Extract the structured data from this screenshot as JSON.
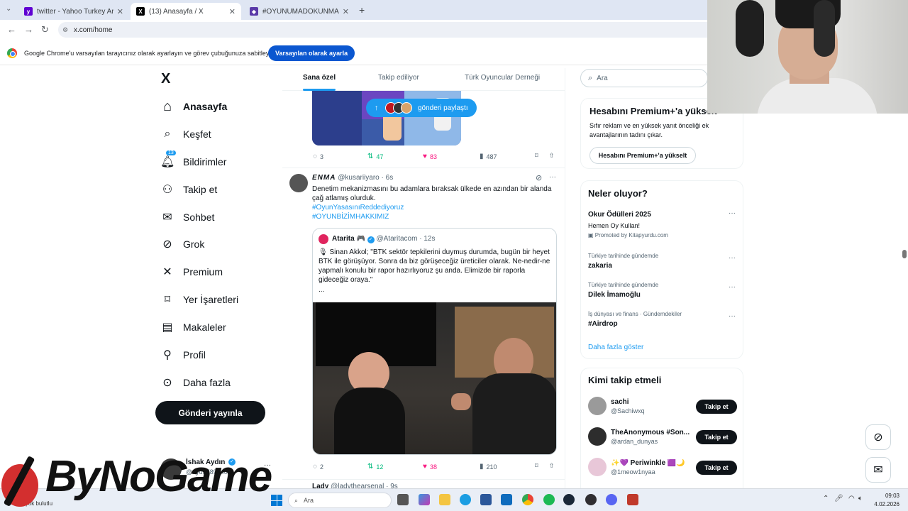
{
  "browser": {
    "tabs": [
      {
        "label": "twitter - Yahoo Turkey Arama S",
        "color": "#6001d2"
      },
      {
        "label": "(13) Anasayfa / X",
        "color": "#000000"
      },
      {
        "label": "#OYUNUMADOKUNMA - Dijita",
        "color": "#5a3aa8"
      }
    ],
    "new_tab": "+",
    "url": "x.com/home"
  },
  "infobar": {
    "message": "Google Chrome'u varsayılan tarayıcınız olarak ayarlayın ve görev çubuğunuza sabitleyin",
    "button": "Varsayılan olarak ayarla"
  },
  "nav": {
    "logo": "X",
    "items": [
      {
        "label": "Anasayfa",
        "icon": "home-icon",
        "glyph": "⌂"
      },
      {
        "label": "Keşfet",
        "icon": "search-icon",
        "glyph": "⌕"
      },
      {
        "label": "Bildirimler",
        "icon": "bell-icon",
        "glyph": "♫",
        "badge": "13"
      },
      {
        "label": "Takip et",
        "icon": "person-add-icon",
        "glyph": "⚇"
      },
      {
        "label": "Sohbet",
        "icon": "mail-icon",
        "glyph": "✉"
      },
      {
        "label": "Grok",
        "icon": "grok-icon",
        "glyph": "⊘"
      },
      {
        "label": "Premium",
        "icon": "x-logo-icon",
        "glyph": "✕"
      },
      {
        "label": "Yer İşaretleri",
        "icon": "bookmark-icon",
        "glyph": "⌑"
      },
      {
        "label": "Makaleler",
        "icon": "article-icon",
        "glyph": "▤"
      },
      {
        "label": "Profil",
        "icon": "profile-icon",
        "glyph": "⚲"
      },
      {
        "label": "Daha fazla",
        "icon": "more-circle-icon",
        "glyph": "⊙"
      }
    ],
    "post_button": "Gönderi yayınla",
    "account": {
      "name": "İshak Aydın",
      "handle": "@ayd97893402",
      "more": "···"
    }
  },
  "feed": {
    "tabs": [
      "Sana özel",
      "Takip ediliyor",
      "Türk Oyuncular Derneği"
    ],
    "shared_pill": "gönderi paylaştı",
    "tweet1": {
      "replies": "3",
      "retweets": "47",
      "likes": "83",
      "views": "487"
    },
    "tweet2": {
      "name": "ENMA",
      "handle": "@kusariiyaro",
      "time": "· 6s",
      "text": "Denetim mekanizmasını bu adamlara bıraksak ülkede en azından bir alanda çağ atlamış olurduk.",
      "hashtag1": "#OyunYasasınıReddediyoruz",
      "hashtag2": "#OYUNBİZİMHAKKIMIZ",
      "quote": {
        "name": "Atarita",
        "flag": "🎮",
        "handle": "@Ataritacom",
        "time": "· 12s",
        "text": "🎙 Sinan Akkol; \"BTK sektör tepkilerini duymuş durumda, bugün bir heyet BTK ile görüşüyor. Sonra da biz görüşeceğiz üreticiler olarak. Ne-nedir-ne yapmalı konulu bir rapor hazırlıyoruz şu anda. Elimizde bir raporla gideceğiz oraya.\"",
        "ellipsis": "..."
      },
      "replies": "2",
      "retweets": "12",
      "likes": "38",
      "views": "210"
    },
    "tweet3": {
      "name": "Lady",
      "handle": "@ladythearsenal",
      "time": "· 9s"
    }
  },
  "right": {
    "search_placeholder": "Ara",
    "premium": {
      "title": "Hesabını Premium+'a yükselt",
      "desc": "Sıfır reklam ve en yüksek yanıt önceliği ek avantajlarının tadını çıkar.",
      "button": "Hesabını Premium+'a yükselt"
    },
    "trends": {
      "title": "Neler oluyor?",
      "items": [
        {
          "top": "Okur Ödülleri 2025",
          "mid": "Hemen Oy Kullan!",
          "bottom": "Promoted by Kitapyurdu.com"
        },
        {
          "top": "Türkiye tarihinde gündemde",
          "mid": "zakaria"
        },
        {
          "top": "Türkiye tarihinde gündemde",
          "mid": "Dilek İmamoğlu"
        },
        {
          "top": "İş dünyası ve finans · Gündemdekiler",
          "mid": "#Airdrop"
        }
      ],
      "more": "Daha fazla göster"
    },
    "who_to_follow": {
      "title": "Kimi takip etmeli",
      "users": [
        {
          "name": "sachi",
          "handle": "@Sachiwxq"
        },
        {
          "name": "TheAnonymous #Son...",
          "handle": "@ardan_dunyas"
        },
        {
          "name": "✨💜 Periwinkle 🟪🌙",
          "handle": "@1meow1nyaa"
        }
      ],
      "button": "Takip et"
    }
  },
  "taskbar": {
    "weather": "Çok bulutlu",
    "search": "Ara",
    "time": "09:03",
    "date": "4.02.2026"
  },
  "watermark": "ByNoGame"
}
